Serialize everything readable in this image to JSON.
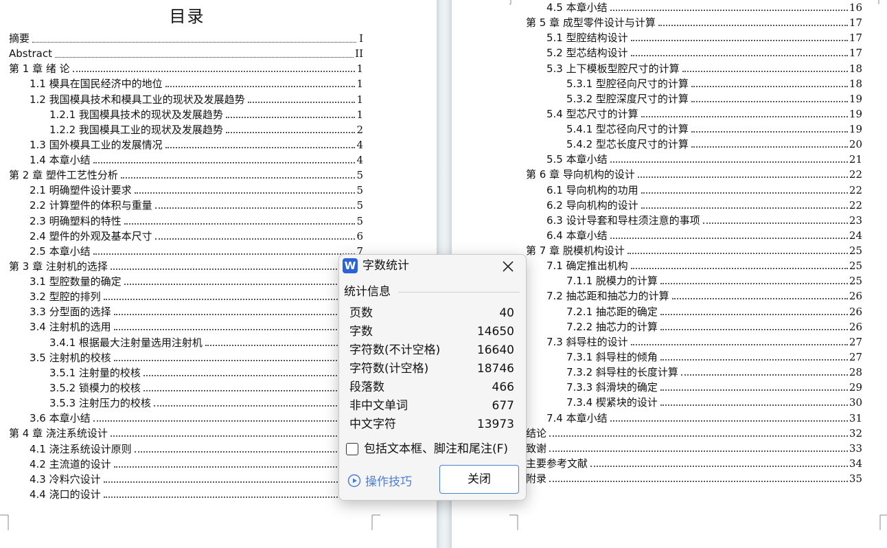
{
  "toc": {
    "title": "目录",
    "left": [
      {
        "text": "摘要",
        "page": "I"
      },
      {
        "text": "Abstract",
        "page": "II"
      },
      {
        "text": "第 1 章  绪  论",
        "page": "1"
      },
      {
        "text": "1.1 模具在国民经济中的地位",
        "page": "1"
      },
      {
        "text": "1.2  我国模具技术和模具工业的现状及发展趋势",
        "page": "1"
      },
      {
        "text": "1.2.1  我国模具技术的现状及发展趋势",
        "page": "1"
      },
      {
        "text": "1.2.2  我国模具工业的现状及发展趋势",
        "page": "2"
      },
      {
        "text": "1.3  国外模具工业的发展情况",
        "page": "4"
      },
      {
        "text": "1.4  本章小结",
        "page": "4"
      },
      {
        "text": "第 2 章  塑件工艺性分析",
        "page": "5"
      },
      {
        "text": "2.1 明确塑件设计要求",
        "page": "5"
      },
      {
        "text": "2.2  计算塑件的体积与重量",
        "page": "5"
      },
      {
        "text": "2.3 明确塑料的特性",
        "page": "5"
      },
      {
        "text": "2.4 塑件的外观及基本尺寸",
        "page": "6"
      },
      {
        "text": "2.5 本章小结",
        "page": "7"
      },
      {
        "text": "第 3 章  注射机的选择",
        "page": ""
      },
      {
        "text": "3.1 型腔数量的确定",
        "page": ""
      },
      {
        "text": "3.2 型腔的排列",
        "page": ""
      },
      {
        "text": "3.3 分型面的选择",
        "page": ""
      },
      {
        "text": "3.4  注射机的选用",
        "page": ""
      },
      {
        "text": "3.4.1  根据最大注射量选用注射机",
        "page": ""
      },
      {
        "text": "3.5 注射机的校核",
        "page": ""
      },
      {
        "text": "3.5.1 注射量的校核",
        "page": ""
      },
      {
        "text": "3.5.2 锁模力的校核",
        "page": ""
      },
      {
        "text": "3.5.3 注射压力的校核",
        "page": ""
      },
      {
        "text": "3.6  本章小结",
        "page": ""
      },
      {
        "text": "第 4 章  浇注系统设计",
        "page": ""
      },
      {
        "text": "4.1  浇注系统设计原则",
        "page": ""
      },
      {
        "text": "4.2  主流道的设计",
        "page": ""
      },
      {
        "text": "4.3 冷料穴设计",
        "page": ""
      },
      {
        "text": "4.4 浇口的设计",
        "page": ""
      }
    ],
    "right": [
      {
        "text": "4.5  本章小结",
        "page": "16"
      },
      {
        "text": "第 5 章  成型零件设计与计算",
        "page": "17"
      },
      {
        "text": "5.1 型腔结构设计",
        "page": "17"
      },
      {
        "text": "5.2  型芯结构设计",
        "page": "17"
      },
      {
        "text": "5.3 上下模板型腔尺寸的计算",
        "page": "18"
      },
      {
        "text": "5.3.1 型腔径向尺寸的计算",
        "page": "18"
      },
      {
        "text": "5.3.2  型腔深度尺寸的计算",
        "page": "19"
      },
      {
        "text": "5.4  型芯尺寸的计算",
        "page": "19"
      },
      {
        "text": "5.4.1  型芯径向尺寸的计算",
        "page": "19"
      },
      {
        "text": "5.4.2  型芯长度尺寸的计算",
        "page": "20"
      },
      {
        "text": "5.5  本章小结",
        "page": "21"
      },
      {
        "text": "第 6 章  导向机构的设计",
        "page": "22"
      },
      {
        "text": "6.1  导向机构的功用",
        "page": "22"
      },
      {
        "text": "6.2  导向机构的设计",
        "page": "22"
      },
      {
        "text": "6.3  设计导套和导柱须注意的事项",
        "page": "23"
      },
      {
        "text": "6.4 本章小结",
        "page": "24"
      },
      {
        "text": "第 7 章  脱模机构设计",
        "page": "25"
      },
      {
        "text": "7.1  确定推出机构",
        "page": "25"
      },
      {
        "text": "7.1.1 脱模力的计算",
        "page": "25"
      },
      {
        "text": "7.2  抽芯距和抽芯力的计算",
        "page": "26"
      },
      {
        "text": "7.2.1 抽芯距的确定",
        "page": "26"
      },
      {
        "text": "7.2.2 抽芯力的计算",
        "page": "26"
      },
      {
        "text": "7.3 斜导柱的设计",
        "page": "27"
      },
      {
        "text": "7.3.1  斜导柱的倾角",
        "page": "27"
      },
      {
        "text": "7.3.2 斜导柱的长度计算",
        "page": "28"
      },
      {
        "text": "7.3.3 斜滑块的确定",
        "page": "29"
      },
      {
        "text": "7.3.4 楔紧块的设计",
        "page": "30"
      },
      {
        "text": "7.4  本章小结",
        "page": "31"
      },
      {
        "text": "结论",
        "page": "32"
      },
      {
        "text": "致谢",
        "page": "33"
      },
      {
        "text": "主要参考文献",
        "page": "34"
      },
      {
        "text": "附录",
        "page": "35"
      }
    ]
  },
  "dialog": {
    "logo": "W",
    "title": "字数统计",
    "section": "统计信息",
    "stats": [
      {
        "label": "页数",
        "value": "40"
      },
      {
        "label": "字数",
        "value": "14650"
      },
      {
        "label": "字符数(不计空格)",
        "value": "16640"
      },
      {
        "label": "字符数(计空格)",
        "value": "18746"
      },
      {
        "label": "段落数",
        "value": "466"
      },
      {
        "label": "非中文单词",
        "value": "677"
      },
      {
        "label": "中文字符",
        "value": "13973"
      }
    ],
    "checkbox_label": "包括文本框、脚注和尾注(F)",
    "tips_label": "操作技巧",
    "close_label": "关闭",
    "accent": "#2b63d6",
    "link_color": "#4a7fd6"
  }
}
